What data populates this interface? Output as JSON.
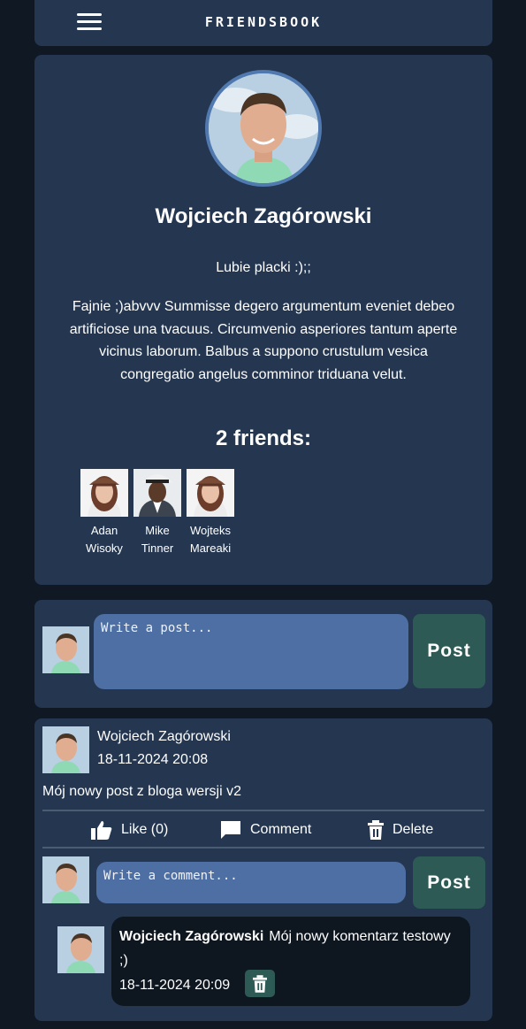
{
  "header": {
    "logo": "FRIENDSBOOK",
    "menu_icon": "hamburger-menu-icon"
  },
  "profile": {
    "name": "Wojciech Zagórowski",
    "status": "Lubie placki :);;",
    "bio": "Fajnie ;)abvvv Summisse degero argumentum eveniet debeo artificiose una tvacuus. Circumvenio asperiores tantum aperte vicinus laborum. Balbus a suppono crustulum vesica congregatio angelus comminor triduana velut.",
    "friends_title": "2 friends:",
    "friends": [
      {
        "first": "Adan",
        "last": "Wisoky"
      },
      {
        "first": "Mike",
        "last": "Tinner"
      },
      {
        "first": "Wojteks",
        "last": "Mareaki"
      }
    ]
  },
  "composer": {
    "placeholder": "Write a post...",
    "button": "Post"
  },
  "post": {
    "author": "Wojciech Zagórowski",
    "date": "18-11-2024 20:08",
    "text": "Mój nowy post z bloga wersji v2",
    "like_label": "Like (0)",
    "comment_label": "Comment",
    "delete_label": "Delete",
    "comment_placeholder": "Write a comment...",
    "comment_button": "Post",
    "comments": [
      {
        "author": "Wojciech Zagórowski",
        "text": "Mój nowy komentarz testowy ;)",
        "date": "18-11-2024 20:09"
      }
    ]
  },
  "colors": {
    "background": "#0f1823",
    "card": "#243650",
    "input": "#4e6fa3",
    "button": "#2d5a54",
    "comment_bubble": "#0e1620"
  }
}
